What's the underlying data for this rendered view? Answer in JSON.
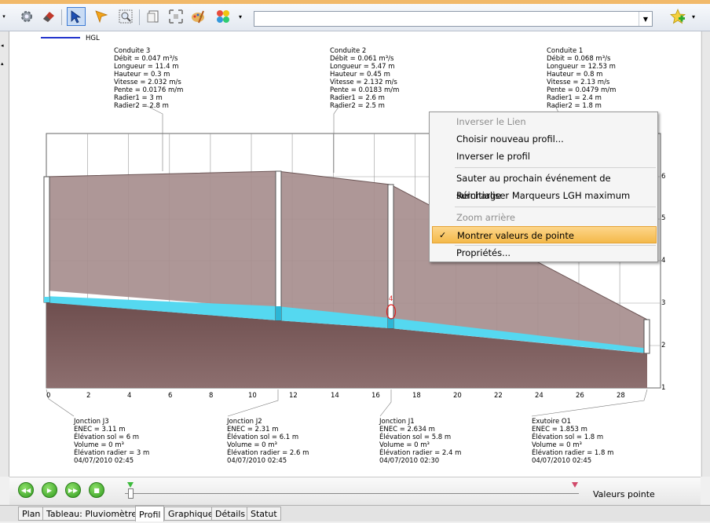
{
  "legend": {
    "label": "HGL",
    "color": "#2233cc"
  },
  "conduits": [
    {
      "lines": [
        "Conduite 3",
        "Débit = 0.047 m³/s",
        "Longueur = 11.4 m",
        "Hauteur = 0.3 m",
        "Vitesse = 2.032 m/s",
        "Pente = 0.0176 m/m",
        "Radier1 = 3 m",
        "Radier2 = 2.8 m"
      ]
    },
    {
      "lines": [
        "Conduite 2",
        "Débit = 0.061 m³/s",
        "Longueur = 5.47 m",
        "Hauteur = 0.45 m",
        "Vitesse = 2.132 m/s",
        "Pente = 0.0183 m/m",
        "Radier1 = 2.6 m",
        "Radier2 = 2.5 m"
      ]
    },
    {
      "lines": [
        "Conduite 1",
        "Débit = 0.068 m³/s",
        "Longueur = 12.53 m",
        "Hauteur = 0.8 m",
        "Vitesse = 2.13 m/s",
        "Pente = 0.0479 m/m",
        "Radier1 = 2.4 m",
        "Radier2 = 1.8 m"
      ]
    }
  ],
  "junctions": [
    {
      "lines": [
        "Jonction J3",
        "ENEC = 3.11 m",
        "Élévation sol = 6 m",
        "Volume = 0 m³",
        "Élévation radier = 3 m",
        "04/07/2010 02:45"
      ]
    },
    {
      "lines": [
        "Jonction J2",
        "ENEC = 2.31 m",
        "Élévation sol = 6.1 m",
        "Volume = 0 m³",
        "Élévation radier = 2.6 m",
        "04/07/2010 02:45"
      ]
    },
    {
      "lines": [
        "Jonction J1",
        "ENEC = 2.634 m",
        "Élévation sol = 5.8 m",
        "Volume = 0 m³",
        "Élévation radier = 2.4 m",
        "04/07/2010 02:30"
      ]
    },
    {
      "lines": [
        "Exutoire O1",
        "ENEC = 1.853 m",
        "Élévation sol = 1.8 m",
        "Volume = 0 m³",
        "Élévation radier = 1.8 m",
        "04/07/2010 02:45"
      ]
    }
  ],
  "x_ticks": [
    "0",
    "2",
    "4",
    "6",
    "8",
    "10",
    "12",
    "14",
    "16",
    "18",
    "20",
    "22",
    "24",
    "26",
    "28"
  ],
  "y_ticks": [
    "1",
    "2",
    "3",
    "4",
    "5",
    "6"
  ],
  "marker_label": "4",
  "context_menu": {
    "items": [
      {
        "label": "Inverser le Lien",
        "disabled": true
      },
      {
        "label": "Choisir nouveau profil...",
        "disabled": false
      },
      {
        "label": "Inverser le profil",
        "disabled": false
      },
      {
        "label": "Sauter au prochain événement de surcharge",
        "disabled": false
      },
      {
        "label": "Réinitialiser Marqueurs LGH maximum",
        "disabled": false
      },
      {
        "label": "Zoom arrière",
        "disabled": true
      },
      {
        "label": "Montrer valeurs de pointe",
        "checked": true,
        "highlighted": true
      },
      {
        "label": "Propriétés...",
        "disabled": false
      }
    ]
  },
  "player": {
    "label": "Valeurs pointe"
  },
  "tabs": [
    "Plan",
    "Tableau: Pluviomètres",
    "Profil",
    "Graphique",
    "Détails",
    "Statut"
  ],
  "active_tab": "Profil",
  "colors": {
    "ground": "#7a5a5a",
    "pipe_fill": "#a78e8e",
    "water": "#55d8f0",
    "highlight": "#f5c060"
  }
}
